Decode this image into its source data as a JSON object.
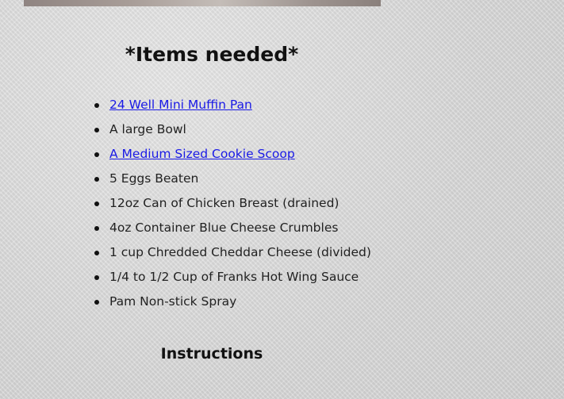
{
  "items_section": {
    "title": "*Items needed*",
    "items": [
      {
        "label": "24 Well Mini Muffin Pan",
        "is_link": true
      },
      {
        "label": "A large Bowl",
        "is_link": false
      },
      {
        "label": "A Medium Sized Cookie Scoop",
        "is_link": true
      },
      {
        "label": "5 Eggs Beaten",
        "is_link": false
      },
      {
        "label": "12oz Can of Chicken Breast (drained)",
        "is_link": false
      },
      {
        "label": "4oz Container Blue Cheese Crumbles",
        "is_link": false
      },
      {
        "label": "1 cup Chredded Cheddar Cheese (divided)",
        "is_link": false
      },
      {
        "label": "1/4 to 1/2 Cup of Franks Hot Wing Sauce",
        "is_link": false
      },
      {
        "label": "Pam Non-stick Spray",
        "is_link": false
      }
    ]
  },
  "instructions_section": {
    "title": "Instructions"
  },
  "colors": {
    "link": "#1a1ae6",
    "text": "#222222",
    "heading": "#111111"
  }
}
